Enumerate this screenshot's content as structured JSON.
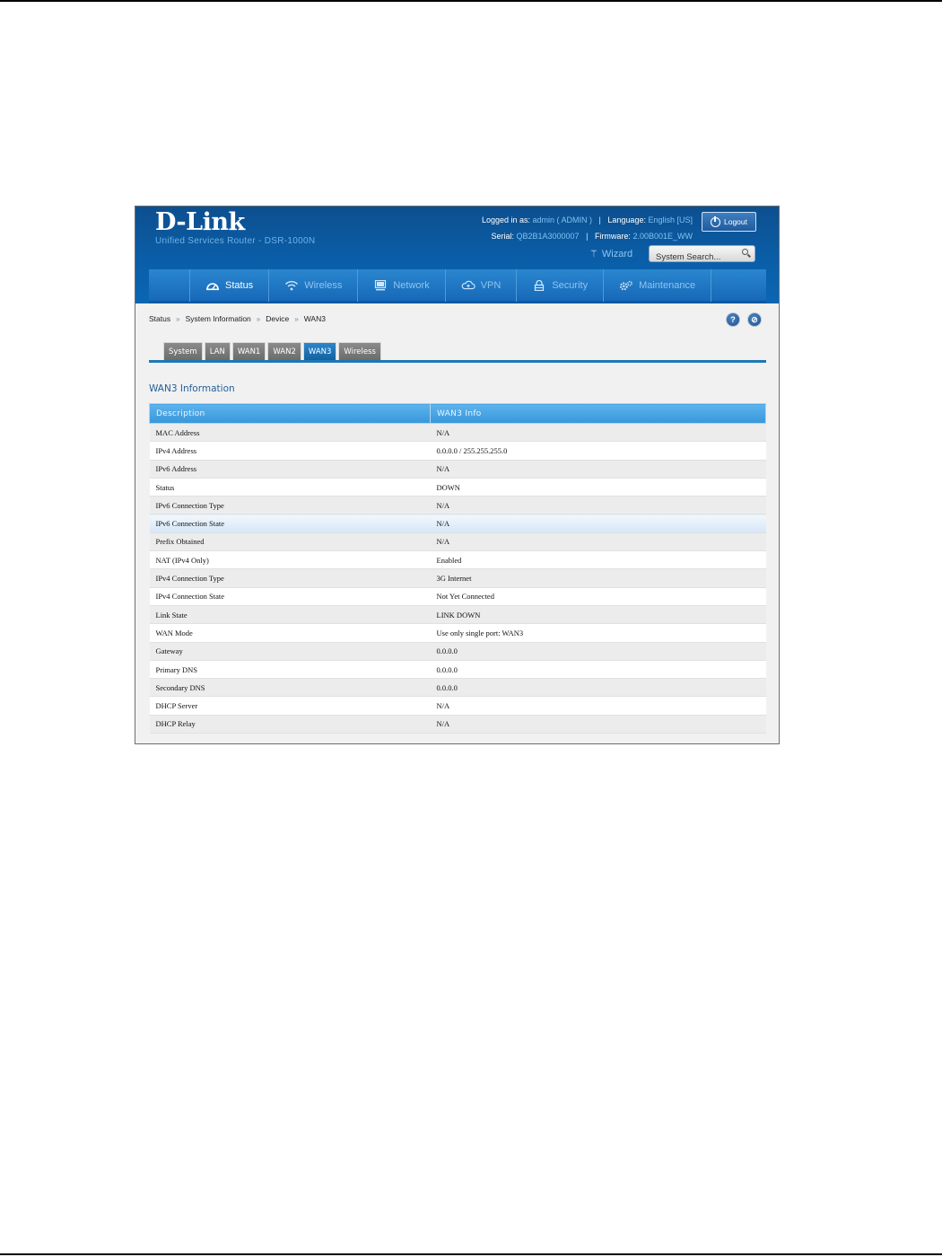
{
  "header": {
    "brand": "D-Link",
    "product": "Unified Services Router - DSR-1000N",
    "logged_in_label": "Logged in as:",
    "logged_in_value": "admin ( ADMIN )",
    "language_label": "Language:",
    "language_value": "English [US]",
    "serial_label": "Serial:",
    "serial_value": "QB2B1A3000007",
    "firmware_label": "Firmware:",
    "firmware_value": "2.00B001E_WW",
    "logout_label": "Logout",
    "wizard_label": "Wizard",
    "search_placeholder": "System Search..."
  },
  "nav": {
    "items": [
      {
        "label": "Status",
        "icon": "dashboard-icon",
        "active": true
      },
      {
        "label": "Wireless",
        "icon": "wifi-icon",
        "active": false
      },
      {
        "label": "Network",
        "icon": "monitor-icon",
        "active": false
      },
      {
        "label": "VPN",
        "icon": "cloud-icon",
        "active": false
      },
      {
        "label": "Security",
        "icon": "lock-icon",
        "active": false
      },
      {
        "label": "Maintenance",
        "icon": "gears-icon",
        "active": false
      }
    ]
  },
  "breadcrumb": [
    "Status",
    "System Information",
    "Device",
    "WAN3"
  ],
  "breadcrumb_separator": "»",
  "help_icons": [
    "?",
    "⊘"
  ],
  "tabs": [
    {
      "label": "System",
      "active": false
    },
    {
      "label": "LAN",
      "active": false
    },
    {
      "label": "WAN1",
      "active": false
    },
    {
      "label": "WAN2",
      "active": false
    },
    {
      "label": "WAN3",
      "active": true
    },
    {
      "label": "Wireless",
      "active": false
    }
  ],
  "section_title": "WAN3 Information",
  "table": {
    "headers": [
      "Description",
      "WAN3 Info"
    ],
    "rows": [
      [
        "MAC Address",
        "N/A"
      ],
      [
        "IPv4 Address",
        "0.0.0.0 / 255.255.255.0"
      ],
      [
        "IPv6 Address",
        "N/A"
      ],
      [
        "Status",
        "DOWN"
      ],
      [
        "IPv6 Connection Type",
        "N/A"
      ],
      [
        "IPv6 Connection State",
        "N/A"
      ],
      [
        "Prefix Obtained",
        "N/A"
      ],
      [
        "NAT (IPv4 Only)",
        "Enabled"
      ],
      [
        "IPv4 Connection Type",
        "3G Internet"
      ],
      [
        "IPv4 Connection State",
        "Not Yet Connected"
      ],
      [
        "Link State",
        "LINK DOWN"
      ],
      [
        "WAN Mode",
        "Use only single port: WAN3"
      ],
      [
        "Gateway",
        "0.0.0.0"
      ],
      [
        "Primary DNS",
        "0.0.0.0"
      ],
      [
        "Secondary DNS",
        "0.0.0.0"
      ],
      [
        "DHCP Server",
        "N/A"
      ],
      [
        "DHCP Relay",
        "N/A"
      ]
    ],
    "highlighted_row": 5
  },
  "colors": {
    "header_blue": "#0a5ea8",
    "nav_blue": "#1769b8",
    "accent_text": "#7fc3f2",
    "active_tab": "#1d78b5",
    "table_header": "#3897da"
  }
}
